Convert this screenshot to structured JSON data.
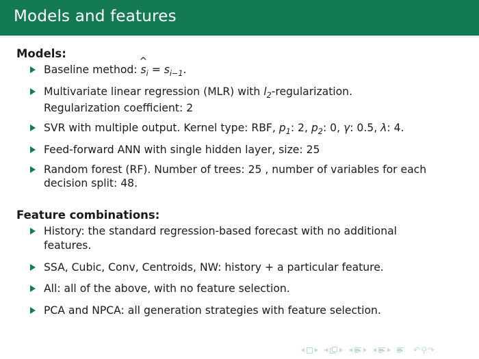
{
  "slide": {
    "title": "Models and features",
    "theme_color": "#137a54",
    "bullet_color": "#1a7a56",
    "text_color": "#1a1a1a"
  },
  "sections": [
    {
      "heading": "Models:",
      "bullets": [
        {
          "id": "baseline",
          "prefix": "Baseline method: ",
          "math": "ŝi = si−1",
          "suffix": "."
        },
        {
          "id": "mlr",
          "line1_pre": "Multivariate linear regression (MLR) with ",
          "math_var": "l",
          "math_sub": "2",
          "line1_post": "-regularization.",
          "line2": "Regularization coefficient: 2"
        },
        {
          "id": "svr",
          "pre": "SVR with multiple output. Kernel type: RBF, ",
          "p1_var": "p",
          "p1_sub": "1",
          "p1_val": ": 2, ",
          "p2_var": "p",
          "p2_sub": "2",
          "p2_val": ": 0, ",
          "gamma": "γ",
          "gamma_val": ": 0.5, ",
          "lambda": "λ",
          "lambda_val": ": 4."
        },
        {
          "id": "ann",
          "text": "Feed-forward ANN with single hidden layer, size: 25"
        },
        {
          "id": "rf",
          "text": "Random forest (RF). Number of trees: 25 , number of variables for each decision split: 48."
        }
      ]
    },
    {
      "heading": "Feature combinations:",
      "bullets": [
        {
          "id": "history",
          "text": "History: the standard regression-based forecast with no additional features."
        },
        {
          "id": "ssa",
          "text": "SSA, Cubic, Conv, Centroids, NW: history + a particular feature."
        },
        {
          "id": "all",
          "text": "All: all of the above, with no feature selection."
        },
        {
          "id": "pca",
          "text": "PCA and NPCA: all generation strategies with feature selection."
        }
      ]
    }
  ],
  "navigation": {
    "items": [
      "prev-slide-icon",
      "slide-icon",
      "next-slide-icon",
      "prev-frame-icon",
      "frame-icon",
      "next-frame-icon",
      "prev-subsection-icon",
      "subsection-icon",
      "next-subsection-icon",
      "prev-section-icon",
      "section-icon",
      "next-section-icon",
      "document-icon",
      "back-icon",
      "search-icon",
      "forward-icon"
    ]
  }
}
